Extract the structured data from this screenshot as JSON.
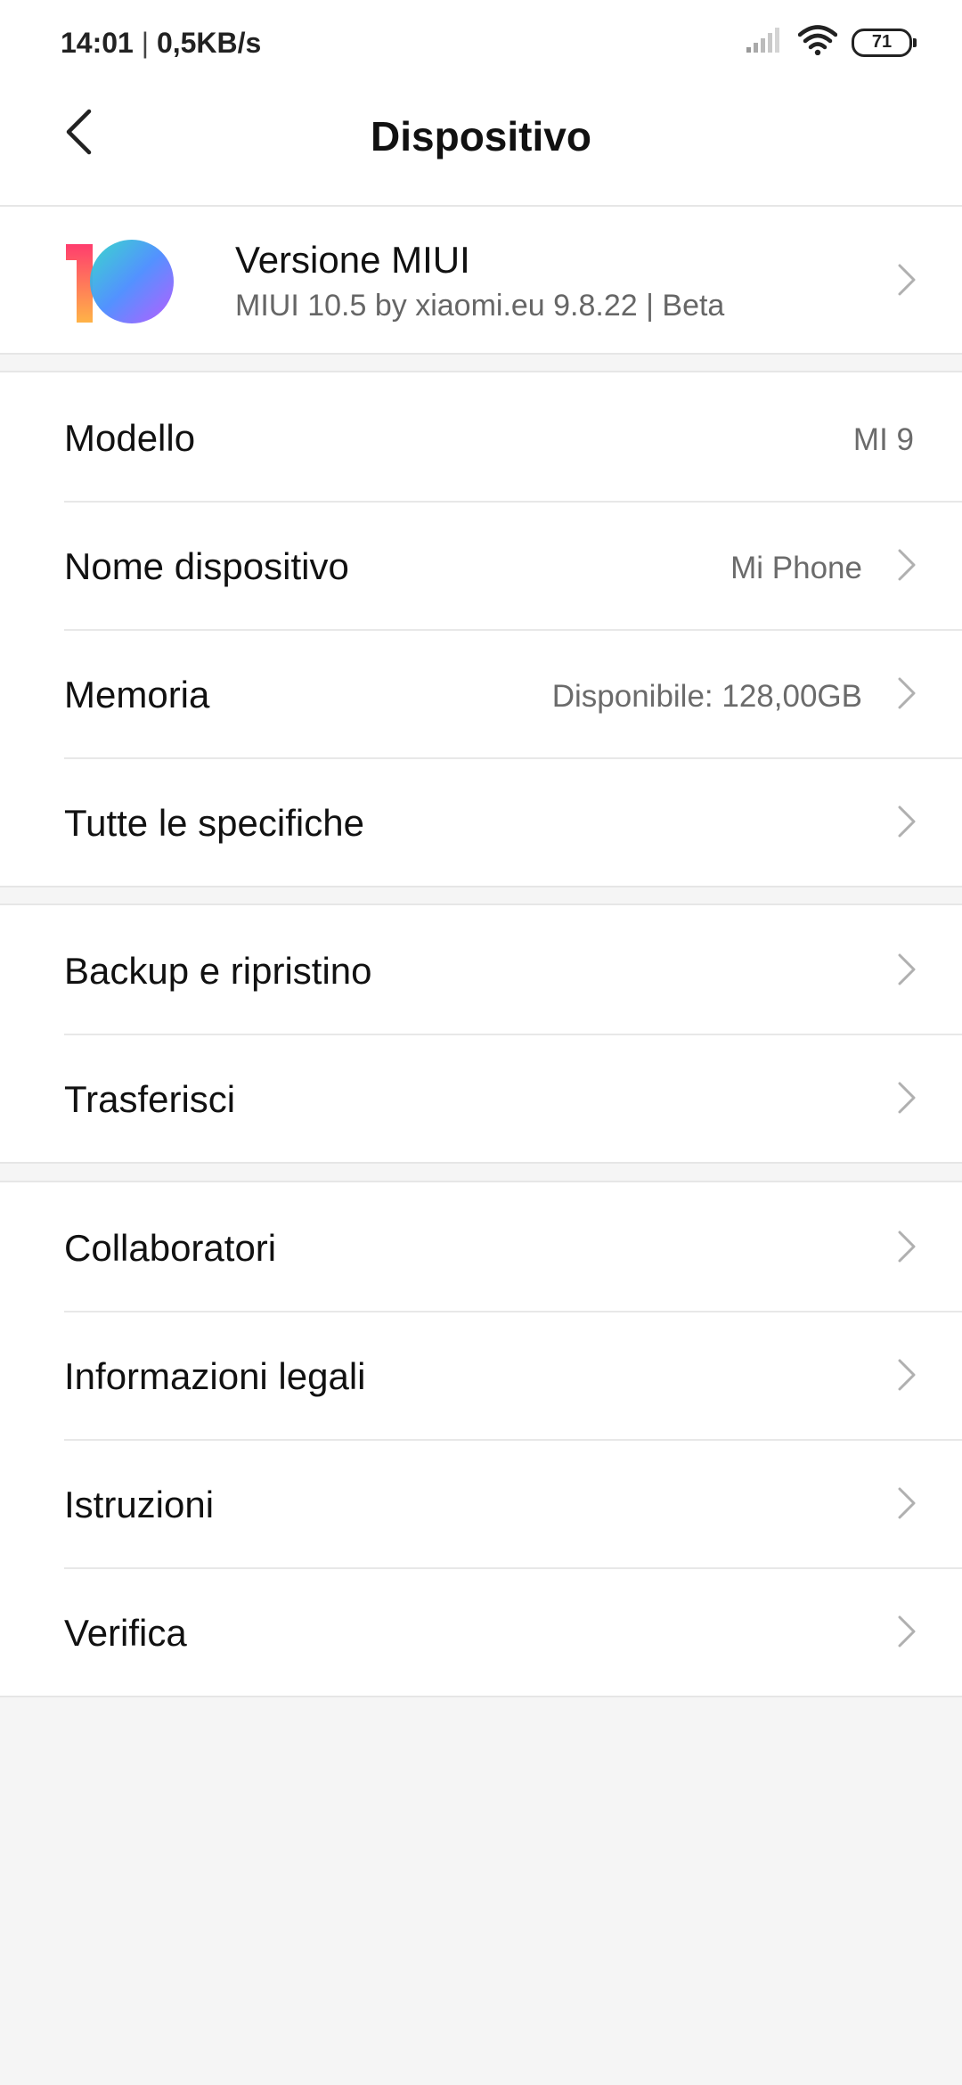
{
  "status_bar": {
    "time": "14:01",
    "separator": "|",
    "net_speed": "0,5KB/s",
    "battery_level": "71",
    "icons": [
      "signal-icon",
      "wifi-icon",
      "battery-icon"
    ]
  },
  "header": {
    "title": "Dispositivo",
    "back_icon": "back-arrow-icon"
  },
  "miui": {
    "title": "Versione MIUI",
    "subtitle": "MIUI 10.5 by xiaomi.eu 9.8.22 | Beta",
    "logo": "miui-10-logo"
  },
  "group1": [
    {
      "label": "Modello",
      "value": "MI 9",
      "chevron": false
    },
    {
      "label": "Nome dispositivo",
      "value": "Mi Phone",
      "chevron": true
    },
    {
      "label": "Memoria",
      "value": "Disponibile: 128,00GB",
      "chevron": true
    },
    {
      "label": "Tutte le specifiche",
      "value": "",
      "chevron": true
    }
  ],
  "group2": [
    {
      "label": "Backup e ripristino",
      "chevron": true
    },
    {
      "label": "Trasferisci",
      "chevron": true
    }
  ],
  "group3": [
    {
      "label": "Collaboratori",
      "chevron": true
    },
    {
      "label": "Informazioni legali",
      "chevron": true
    },
    {
      "label": "Istruzioni",
      "chevron": true
    },
    {
      "label": "Verifica",
      "chevron": true
    }
  ],
  "colors": {
    "background": "#f5f5f5",
    "card": "#ffffff",
    "primary_text": "#111111",
    "secondary_text": "#6b6b6b",
    "chevron": "#b0b0b0",
    "divider": "#e8e8e8"
  }
}
